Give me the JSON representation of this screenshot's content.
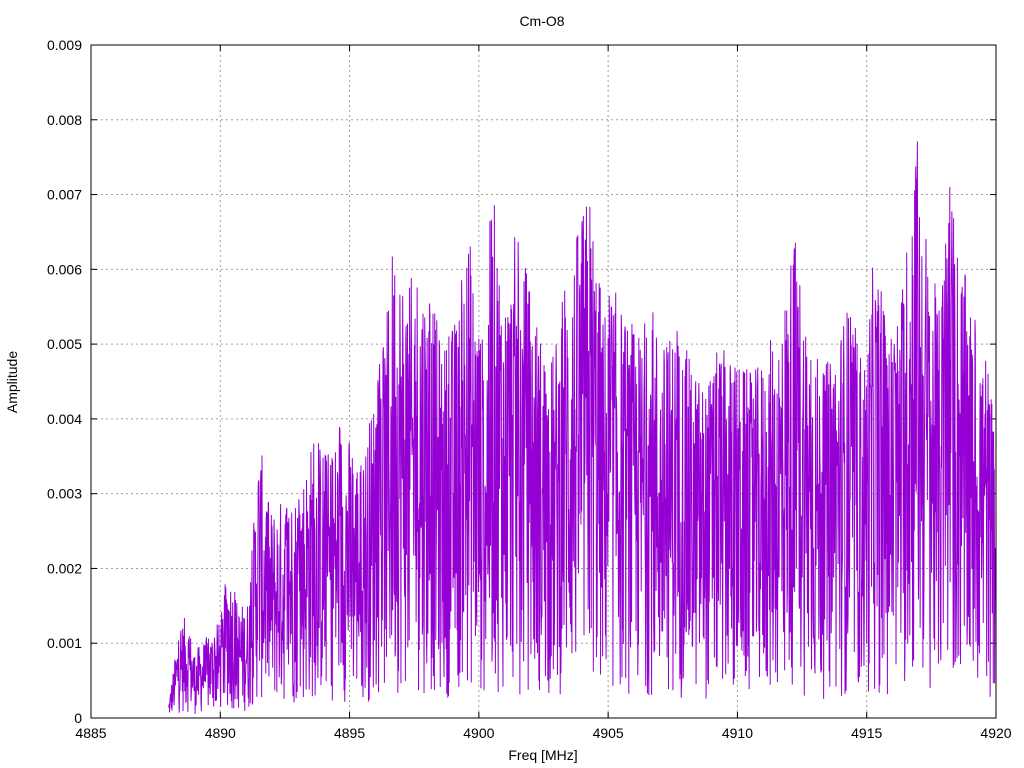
{
  "chart_data": {
    "type": "line",
    "title": "Cm-O8",
    "xlabel": "Freq [MHz]",
    "ylabel": "Amplitude",
    "xlim": [
      4885,
      4920
    ],
    "ylim": [
      0,
      0.009
    ],
    "xticks": [
      "4885",
      "4890",
      "4895",
      "4900",
      "4905",
      "4910",
      "4915",
      "4920"
    ],
    "yticks": [
      "0",
      "0.001",
      "0.002",
      "0.003",
      "0.004",
      "0.005",
      "0.006",
      "0.007",
      "0.008",
      "0.009"
    ],
    "grid": true,
    "line_color": "#9400d3",
    "series": [
      {
        "x_start": 4888.0,
        "x_end": 4920.0,
        "sampled_peaks": [
          [
            4888.0,
            0.0002
          ],
          [
            4888.4,
            0.0012
          ],
          [
            4888.7,
            0.0014
          ],
          [
            4889.0,
            0.0009
          ],
          [
            4889.5,
            0.0011
          ],
          [
            4890.0,
            0.0013
          ],
          [
            4890.3,
            0.0021
          ],
          [
            4890.7,
            0.0015
          ],
          [
            4891.1,
            0.0016
          ],
          [
            4891.5,
            0.0038
          ],
          [
            4891.9,
            0.0028
          ],
          [
            4892.5,
            0.003
          ],
          [
            4893.0,
            0.0031
          ],
          [
            4893.6,
            0.0038
          ],
          [
            4894.2,
            0.0036
          ],
          [
            4894.7,
            0.004
          ],
          [
            4895.1,
            0.0037
          ],
          [
            4895.5,
            0.0035
          ],
          [
            4896.0,
            0.0045
          ],
          [
            4896.4,
            0.0052
          ],
          [
            4896.7,
            0.0066
          ],
          [
            4897.3,
            0.0058
          ],
          [
            4897.7,
            0.0063
          ],
          [
            4898.0,
            0.0059
          ],
          [
            4898.6,
            0.005
          ],
          [
            4899.2,
            0.0055
          ],
          [
            4899.6,
            0.0066
          ],
          [
            4900.2,
            0.005
          ],
          [
            4900.5,
            0.0072
          ],
          [
            4901.0,
            0.0058
          ],
          [
            4901.4,
            0.0065
          ],
          [
            4901.9,
            0.006
          ],
          [
            4902.4,
            0.0052
          ],
          [
            4902.9,
            0.0049
          ],
          [
            4903.3,
            0.006
          ],
          [
            4903.7,
            0.0064
          ],
          [
            4904.3,
            0.0072
          ],
          [
            4904.8,
            0.0055
          ],
          [
            4905.2,
            0.0058
          ],
          [
            4905.7,
            0.0054
          ],
          [
            4906.2,
            0.0052
          ],
          [
            4906.7,
            0.0056
          ],
          [
            4907.1,
            0.005
          ],
          [
            4907.6,
            0.0053
          ],
          [
            4908.2,
            0.0048
          ],
          [
            4908.8,
            0.0045
          ],
          [
            4909.3,
            0.005
          ],
          [
            4910.0,
            0.0048
          ],
          [
            4910.6,
            0.0046
          ],
          [
            4911.2,
            0.005
          ],
          [
            4911.7,
            0.0055
          ],
          [
            4912.2,
            0.0066
          ],
          [
            4912.7,
            0.0055
          ],
          [
            4913.3,
            0.0046
          ],
          [
            4913.8,
            0.0052
          ],
          [
            4914.3,
            0.0056
          ],
          [
            4914.9,
            0.0048
          ],
          [
            4915.3,
            0.0063
          ],
          [
            4915.8,
            0.0052
          ],
          [
            4916.3,
            0.0056
          ],
          [
            4916.9,
            0.0081
          ],
          [
            4917.4,
            0.0063
          ],
          [
            4917.8,
            0.0055
          ],
          [
            4918.2,
            0.0073
          ],
          [
            4918.6,
            0.0063
          ],
          [
            4919.1,
            0.0054
          ],
          [
            4919.6,
            0.0051
          ],
          [
            4920.0,
            0.0036
          ]
        ]
      }
    ]
  }
}
